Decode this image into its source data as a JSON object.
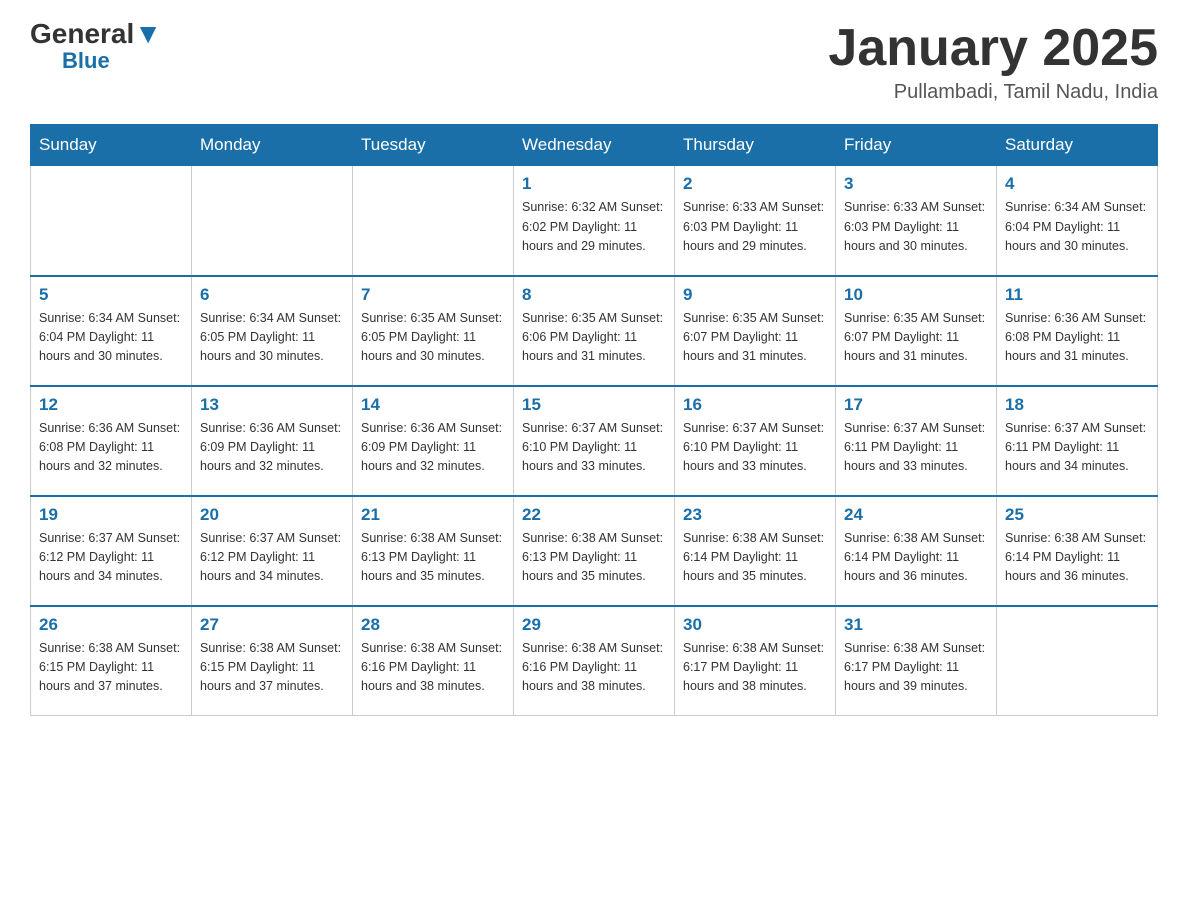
{
  "header": {
    "logo_general": "General",
    "logo_blue": "Blue",
    "month_title": "January 2025",
    "location": "Pullambadi, Tamil Nadu, India"
  },
  "days_of_week": [
    "Sunday",
    "Monday",
    "Tuesday",
    "Wednesday",
    "Thursday",
    "Friday",
    "Saturday"
  ],
  "weeks": [
    [
      {
        "day": "",
        "info": ""
      },
      {
        "day": "",
        "info": ""
      },
      {
        "day": "",
        "info": ""
      },
      {
        "day": "1",
        "info": "Sunrise: 6:32 AM\nSunset: 6:02 PM\nDaylight: 11 hours\nand 29 minutes."
      },
      {
        "day": "2",
        "info": "Sunrise: 6:33 AM\nSunset: 6:03 PM\nDaylight: 11 hours\nand 29 minutes."
      },
      {
        "day": "3",
        "info": "Sunrise: 6:33 AM\nSunset: 6:03 PM\nDaylight: 11 hours\nand 30 minutes."
      },
      {
        "day": "4",
        "info": "Sunrise: 6:34 AM\nSunset: 6:04 PM\nDaylight: 11 hours\nand 30 minutes."
      }
    ],
    [
      {
        "day": "5",
        "info": "Sunrise: 6:34 AM\nSunset: 6:04 PM\nDaylight: 11 hours\nand 30 minutes."
      },
      {
        "day": "6",
        "info": "Sunrise: 6:34 AM\nSunset: 6:05 PM\nDaylight: 11 hours\nand 30 minutes."
      },
      {
        "day": "7",
        "info": "Sunrise: 6:35 AM\nSunset: 6:05 PM\nDaylight: 11 hours\nand 30 minutes."
      },
      {
        "day": "8",
        "info": "Sunrise: 6:35 AM\nSunset: 6:06 PM\nDaylight: 11 hours\nand 31 minutes."
      },
      {
        "day": "9",
        "info": "Sunrise: 6:35 AM\nSunset: 6:07 PM\nDaylight: 11 hours\nand 31 minutes."
      },
      {
        "day": "10",
        "info": "Sunrise: 6:35 AM\nSunset: 6:07 PM\nDaylight: 11 hours\nand 31 minutes."
      },
      {
        "day": "11",
        "info": "Sunrise: 6:36 AM\nSunset: 6:08 PM\nDaylight: 11 hours\nand 31 minutes."
      }
    ],
    [
      {
        "day": "12",
        "info": "Sunrise: 6:36 AM\nSunset: 6:08 PM\nDaylight: 11 hours\nand 32 minutes."
      },
      {
        "day": "13",
        "info": "Sunrise: 6:36 AM\nSunset: 6:09 PM\nDaylight: 11 hours\nand 32 minutes."
      },
      {
        "day": "14",
        "info": "Sunrise: 6:36 AM\nSunset: 6:09 PM\nDaylight: 11 hours\nand 32 minutes."
      },
      {
        "day": "15",
        "info": "Sunrise: 6:37 AM\nSunset: 6:10 PM\nDaylight: 11 hours\nand 33 minutes."
      },
      {
        "day": "16",
        "info": "Sunrise: 6:37 AM\nSunset: 6:10 PM\nDaylight: 11 hours\nand 33 minutes."
      },
      {
        "day": "17",
        "info": "Sunrise: 6:37 AM\nSunset: 6:11 PM\nDaylight: 11 hours\nand 33 minutes."
      },
      {
        "day": "18",
        "info": "Sunrise: 6:37 AM\nSunset: 6:11 PM\nDaylight: 11 hours\nand 34 minutes."
      }
    ],
    [
      {
        "day": "19",
        "info": "Sunrise: 6:37 AM\nSunset: 6:12 PM\nDaylight: 11 hours\nand 34 minutes."
      },
      {
        "day": "20",
        "info": "Sunrise: 6:37 AM\nSunset: 6:12 PM\nDaylight: 11 hours\nand 34 minutes."
      },
      {
        "day": "21",
        "info": "Sunrise: 6:38 AM\nSunset: 6:13 PM\nDaylight: 11 hours\nand 35 minutes."
      },
      {
        "day": "22",
        "info": "Sunrise: 6:38 AM\nSunset: 6:13 PM\nDaylight: 11 hours\nand 35 minutes."
      },
      {
        "day": "23",
        "info": "Sunrise: 6:38 AM\nSunset: 6:14 PM\nDaylight: 11 hours\nand 35 minutes."
      },
      {
        "day": "24",
        "info": "Sunrise: 6:38 AM\nSunset: 6:14 PM\nDaylight: 11 hours\nand 36 minutes."
      },
      {
        "day": "25",
        "info": "Sunrise: 6:38 AM\nSunset: 6:14 PM\nDaylight: 11 hours\nand 36 minutes."
      }
    ],
    [
      {
        "day": "26",
        "info": "Sunrise: 6:38 AM\nSunset: 6:15 PM\nDaylight: 11 hours\nand 37 minutes."
      },
      {
        "day": "27",
        "info": "Sunrise: 6:38 AM\nSunset: 6:15 PM\nDaylight: 11 hours\nand 37 minutes."
      },
      {
        "day": "28",
        "info": "Sunrise: 6:38 AM\nSunset: 6:16 PM\nDaylight: 11 hours\nand 38 minutes."
      },
      {
        "day": "29",
        "info": "Sunrise: 6:38 AM\nSunset: 6:16 PM\nDaylight: 11 hours\nand 38 minutes."
      },
      {
        "day": "30",
        "info": "Sunrise: 6:38 AM\nSunset: 6:17 PM\nDaylight: 11 hours\nand 38 minutes."
      },
      {
        "day": "31",
        "info": "Sunrise: 6:38 AM\nSunset: 6:17 PM\nDaylight: 11 hours\nand 39 minutes."
      },
      {
        "day": "",
        "info": ""
      }
    ]
  ]
}
